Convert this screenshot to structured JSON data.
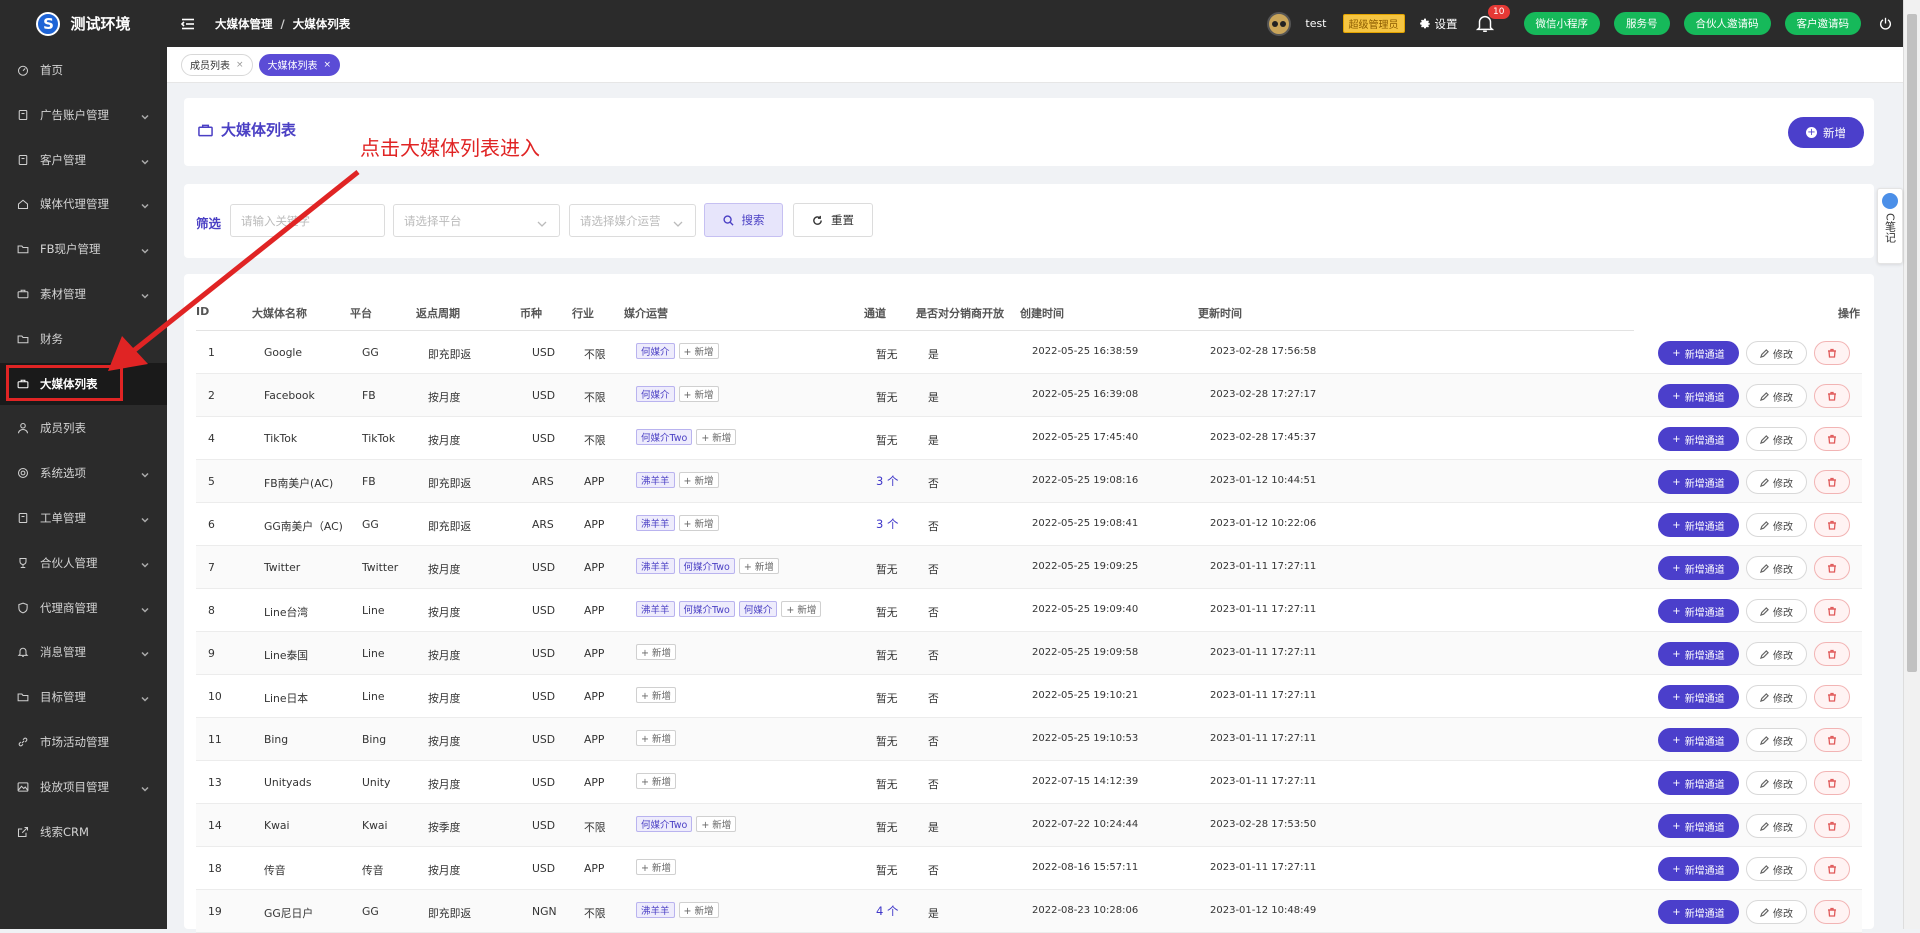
{
  "app": {
    "title": "测试环境",
    "logo_letter": "S"
  },
  "sidebar": {
    "items": [
      {
        "label": "首页",
        "icon": "dashboard-icon",
        "has_children": false
      },
      {
        "label": "广告账户管理",
        "icon": "clipboard-icon",
        "has_children": true
      },
      {
        "label": "客户管理",
        "icon": "clipboard-icon",
        "has_children": true
      },
      {
        "label": "媒体代理管理",
        "icon": "home-icon",
        "has_children": true
      },
      {
        "label": "FB现户管理",
        "icon": "folder-icon",
        "has_children": true
      },
      {
        "label": "素材管理",
        "icon": "briefcase-icon",
        "has_children": true
      },
      {
        "label": "财务",
        "icon": "folder-icon",
        "has_children": false
      },
      {
        "label": "大媒体列表",
        "icon": "briefcase-icon",
        "has_children": false,
        "active": true
      },
      {
        "label": "成员列表",
        "icon": "user-icon",
        "has_children": false
      },
      {
        "label": "系统选项",
        "icon": "gear-icon",
        "has_children": true
      },
      {
        "label": "工单管理",
        "icon": "clipboard-icon",
        "has_children": true
      },
      {
        "label": "合伙人管理",
        "icon": "trophy-icon",
        "has_children": true
      },
      {
        "label": "代理商管理",
        "icon": "shield-icon",
        "has_children": true
      },
      {
        "label": "消息管理",
        "icon": "bell-icon",
        "has_children": true
      },
      {
        "label": "目标管理",
        "icon": "folder-icon",
        "has_children": true
      },
      {
        "label": "市场活动管理",
        "icon": "link-icon",
        "has_children": false
      },
      {
        "label": "投放项目管理",
        "icon": "image-icon",
        "has_children": true
      },
      {
        "label": "线索CRM",
        "icon": "external-link-icon",
        "has_children": false
      }
    ]
  },
  "header": {
    "breadcrumb": [
      "大媒体管理",
      "大媒体列表"
    ],
    "breadcrumb_sep": "/",
    "username": "test",
    "role": "超级管理员",
    "settings_label": "设置",
    "notification_count": "10",
    "buttons": [
      "微信小程序",
      "服务号",
      "合伙人邀请码",
      "客户邀请码"
    ]
  },
  "tabs": [
    {
      "label": "成员列表",
      "active": false,
      "close": "×"
    },
    {
      "label": "大媒体列表",
      "active": true,
      "close": "×"
    }
  ],
  "page": {
    "title": "大媒体列表",
    "add_label": "新增"
  },
  "annotation": {
    "text": "点击大媒体列表进入",
    "color": "#e02424"
  },
  "filter": {
    "label": "筛选",
    "keyword_placeholder": "请输入关键字",
    "platform_placeholder": "请选择平台",
    "operator_placeholder": "请选择媒介运营",
    "search_label": "搜索",
    "reset_label": "重置"
  },
  "table": {
    "columns": [
      "ID",
      "大媒体名称",
      "平台",
      "返点周期",
      "币种",
      "行业",
      "媒介运营",
      "通道",
      "是否对分销商开放",
      "创建时间",
      "更新时间",
      "操作"
    ],
    "add_chip": "+ 新增",
    "action_new_channel": "新增通道",
    "action_edit": "修改",
    "rows": [
      {
        "id": "1",
        "name": "Google",
        "platform": "GG",
        "cycle": "即充即返",
        "currency": "USD",
        "industry": "不限",
        "operators": [
          "何媒介"
        ],
        "channel": "暂无",
        "channel_link": false,
        "open": "是",
        "created": "2022-05-25 16:38:59",
        "updated": "2023-02-28 17:56:58"
      },
      {
        "id": "2",
        "name": "Facebook",
        "platform": "FB",
        "cycle": "按月度",
        "currency": "USD",
        "industry": "不限",
        "operators": [
          "何媒介"
        ],
        "channel": "暂无",
        "channel_link": false,
        "open": "是",
        "created": "2022-05-25 16:39:08",
        "updated": "2023-02-28 17:27:17"
      },
      {
        "id": "4",
        "name": "TikTok",
        "platform": "TikTok",
        "cycle": "按月度",
        "currency": "USD",
        "industry": "不限",
        "operators": [
          "何媒介Two"
        ],
        "channel": "暂无",
        "channel_link": false,
        "open": "是",
        "created": "2022-05-25 17:45:40",
        "updated": "2023-02-28 17:45:37"
      },
      {
        "id": "5",
        "name": "FB南美户(AC)",
        "platform": "FB",
        "cycle": "即充即返",
        "currency": "ARS",
        "industry": "APP",
        "operators": [
          "沸羊羊"
        ],
        "channel": "3 个",
        "channel_link": true,
        "open": "否",
        "created": "2022-05-25 19:08:16",
        "updated": "2023-01-12 10:44:51"
      },
      {
        "id": "6",
        "name": "GG南美户（AC)",
        "platform": "GG",
        "cycle": "即充即返",
        "currency": "ARS",
        "industry": "APP",
        "operators": [
          "沸羊羊"
        ],
        "channel": "3 个",
        "channel_link": true,
        "open": "否",
        "created": "2022-05-25 19:08:41",
        "updated": "2023-01-12 10:22:06"
      },
      {
        "id": "7",
        "name": "Twitter",
        "platform": "Twitter",
        "cycle": "按月度",
        "currency": "USD",
        "industry": "APP",
        "operators": [
          "沸羊羊",
          "何媒介Two"
        ],
        "channel": "暂无",
        "channel_link": false,
        "open": "否",
        "created": "2022-05-25 19:09:25",
        "updated": "2023-01-11 17:27:11"
      },
      {
        "id": "8",
        "name": "Line台湾",
        "platform": "Line",
        "cycle": "按月度",
        "currency": "USD",
        "industry": "APP",
        "operators": [
          "沸羊羊",
          "何媒介Two",
          "何媒介"
        ],
        "channel": "暂无",
        "channel_link": false,
        "open": "否",
        "created": "2022-05-25 19:09:40",
        "updated": "2023-01-11 17:27:11"
      },
      {
        "id": "9",
        "name": "Line泰国",
        "platform": "Line",
        "cycle": "按月度",
        "currency": "USD",
        "industry": "APP",
        "operators": [],
        "channel": "暂无",
        "channel_link": false,
        "open": "否",
        "created": "2022-05-25 19:09:58",
        "updated": "2023-01-11 17:27:11"
      },
      {
        "id": "10",
        "name": "Line日本",
        "platform": "Line",
        "cycle": "按月度",
        "currency": "USD",
        "industry": "APP",
        "operators": [],
        "channel": "暂无",
        "channel_link": false,
        "open": "否",
        "created": "2022-05-25 19:10:21",
        "updated": "2023-01-11 17:27:11"
      },
      {
        "id": "11",
        "name": "Bing",
        "platform": "Bing",
        "cycle": "按月度",
        "currency": "USD",
        "industry": "APP",
        "operators": [],
        "channel": "暂无",
        "channel_link": false,
        "open": "否",
        "created": "2022-05-25 19:10:53",
        "updated": "2023-01-11 17:27:11"
      },
      {
        "id": "13",
        "name": "Unityads",
        "platform": "Unity",
        "cycle": "按月度",
        "currency": "USD",
        "industry": "APP",
        "operators": [],
        "channel": "暂无",
        "channel_link": false,
        "open": "否",
        "created": "2022-07-15 14:12:39",
        "updated": "2023-01-11 17:27:11"
      },
      {
        "id": "14",
        "name": "Kwai",
        "platform": "Kwai",
        "cycle": "按季度",
        "currency": "USD",
        "industry": "不限",
        "operators": [
          "何媒介Two"
        ],
        "channel": "暂无",
        "channel_link": false,
        "open": "是",
        "created": "2022-07-22 10:24:44",
        "updated": "2023-02-28 17:53:50"
      },
      {
        "id": "18",
        "name": "传音",
        "platform": "传音",
        "cycle": "按月度",
        "currency": "USD",
        "industry": "APP",
        "operators": [],
        "channel": "暂无",
        "channel_link": false,
        "open": "否",
        "created": "2022-08-16 15:57:11",
        "updated": "2023-01-11 17:27:11"
      },
      {
        "id": "19",
        "name": "GG尼日户",
        "platform": "GG",
        "cycle": "即充即返",
        "currency": "NGN",
        "industry": "不限",
        "operators": [
          "沸羊羊"
        ],
        "channel": "4 个",
        "channel_link": true,
        "open": "是",
        "created": "2022-08-23 10:28:06",
        "updated": "2023-01-12 10:48:49"
      }
    ]
  },
  "float_note": {
    "label": "C笔记"
  },
  "colors": {
    "sidebar_bg": "#2b2b2b",
    "accent": "#4b3fcb",
    "green": "#16b95a",
    "annotation": "#e02424"
  }
}
